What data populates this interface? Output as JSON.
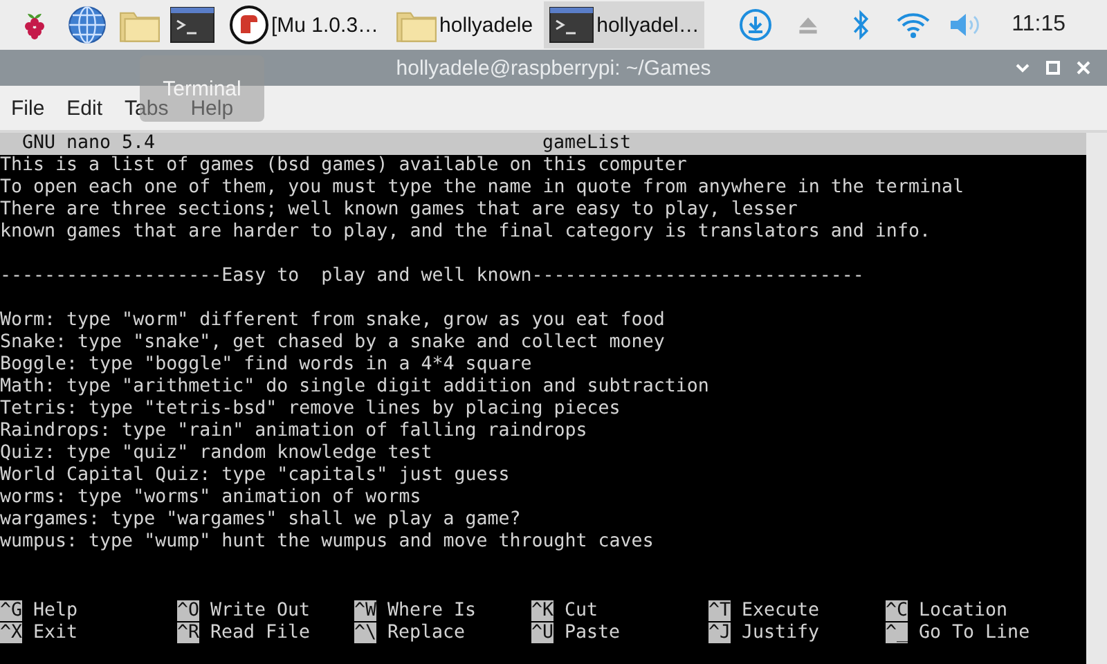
{
  "taskbar": {
    "tasks": [
      {
        "label": "[Mu 1.0.3…",
        "selected": false
      },
      {
        "label": "hollyadele",
        "selected": false
      },
      {
        "label": "hollyadel…",
        "selected": true
      }
    ],
    "clock": "11:15"
  },
  "window": {
    "title": "hollyadele@raspberrypi: ~/Games",
    "menu": [
      "File",
      "Edit",
      "Tabs",
      "Help"
    ],
    "tooltip": "Terminal"
  },
  "nano": {
    "version": "GNU nano 5.4",
    "filename": "gameList",
    "paragraphs": [
      [
        "This is a list of games (bsd games) available on this computer",
        "To open each one of them, you must type the name in quote from anywhere in the terminal",
        "There are three sections; well known games that are easy to play, lesser",
        "known games that are harder to play, and the final category is translators and info."
      ],
      [
        "--------------------Easy to  play and well known------------------------------"
      ],
      [
        "Worm: type \"worm\" different from snake, grow as you eat food",
        "Snake: type \"snake\", get chased by a snake and collect money",
        "Boggle: type \"boggle\" find words in a 4*4 square",
        "Math: type \"arithmetic\" do single digit addition and subtraction",
        "Tetris: type \"tetris-bsd\" remove lines by placing pieces",
        "Raindrops: type \"rain\" animation of falling raindrops",
        "Quiz: type \"quiz\" random knowledge test",
        "World Capital Quiz: type \"capitals\" just guess",
        "worms: type \"worms\" animation of worms",
        "wargames: type \"wargames\" shall we play a game?",
        "wumpus: type \"wump\" hunt the wumpus and move throught caves"
      ]
    ],
    "shortcuts": [
      [
        {
          "key": "^G",
          "label": "Help"
        },
        {
          "key": "^X",
          "label": "Exit"
        }
      ],
      [
        {
          "key": "^O",
          "label": "Write Out"
        },
        {
          "key": "^R",
          "label": "Read File"
        }
      ],
      [
        {
          "key": "^W",
          "label": "Where Is"
        },
        {
          "key": "^\\",
          "label": "Replace"
        }
      ],
      [
        {
          "key": "^K",
          "label": "Cut"
        },
        {
          "key": "^U",
          "label": "Paste"
        }
      ],
      [
        {
          "key": "^T",
          "label": "Execute"
        },
        {
          "key": "^J",
          "label": "Justify"
        }
      ],
      [
        {
          "key": "^C",
          "label": "Location"
        },
        {
          "key": "^_",
          "label": "Go To Line"
        }
      ]
    ]
  }
}
